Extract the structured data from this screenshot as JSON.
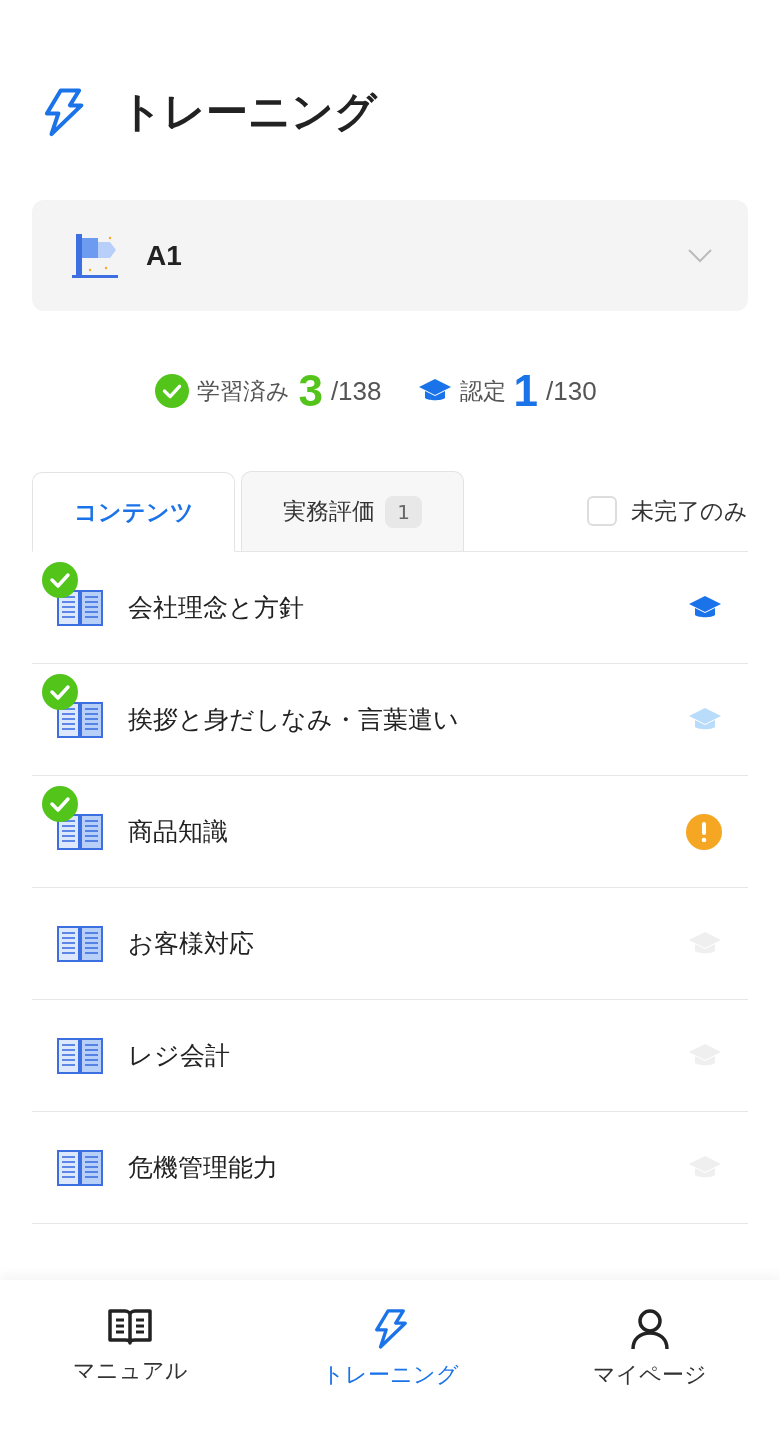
{
  "header": {
    "title": "トレーニング"
  },
  "level_selector": {
    "value": "A1"
  },
  "stats": {
    "learned_label": "学習済み",
    "learned_count": "3",
    "learned_total": "/138",
    "certified_label": "認定",
    "certified_count": "1",
    "certified_total": "/130"
  },
  "tabs": [
    {
      "label": "コンテンツ",
      "selected": true
    },
    {
      "label": "実務評価",
      "badge": "1",
      "selected": false
    }
  ],
  "filter": {
    "label": "未完了のみ",
    "checked": false
  },
  "items": [
    {
      "title": "会社理念と方針",
      "learned": true,
      "kind": "certified"
    },
    {
      "title": "挨拶と身だしなみ・言葉遣い",
      "learned": true,
      "kind": "pending"
    },
    {
      "title": "商品知識",
      "learned": true,
      "kind": "warning"
    },
    {
      "title": "お客様対応",
      "learned": false,
      "kind": "locked"
    },
    {
      "title": "レジ会計",
      "learned": false,
      "kind": "locked"
    },
    {
      "title": "危機管理能力",
      "learned": false,
      "kind": "locked"
    }
  ],
  "nav": [
    {
      "label": "マニュアル",
      "kind": "book",
      "selected": false
    },
    {
      "label": "トレーニング",
      "kind": "bolt",
      "selected": true
    },
    {
      "label": "マイページ",
      "kind": "user",
      "selected": false
    }
  ]
}
